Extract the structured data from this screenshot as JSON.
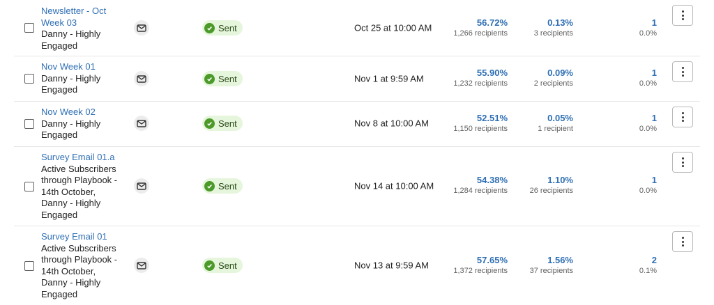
{
  "rows": [
    {
      "title": "Newsletter - Oct Week 03",
      "audience": "Danny - Highly Engaged",
      "status": "Sent",
      "date": "Oct 25 at 10:00 AM",
      "open_rate": "56.72%",
      "open_recipients": "1,266 recipients",
      "click_rate": "0.13%",
      "click_recipients": "3 recipients",
      "unsub_count": "1",
      "unsub_rate": "0.0%"
    },
    {
      "title": "Nov Week 01",
      "audience": "Danny - Highly Engaged",
      "status": "Sent",
      "date": "Nov 1 at 9:59 AM",
      "open_rate": "55.90%",
      "open_recipients": "1,232 recipients",
      "click_rate": "0.09%",
      "click_recipients": "2 recipients",
      "unsub_count": "1",
      "unsub_rate": "0.0%"
    },
    {
      "title": "Nov Week 02",
      "audience": "Danny - Highly Engaged",
      "status": "Sent",
      "date": "Nov 8 at 10:00 AM",
      "open_rate": "52.51%",
      "open_recipients": "1,150 recipients",
      "click_rate": "0.05%",
      "click_recipients": "1 recipient",
      "unsub_count": "1",
      "unsub_rate": "0.0%"
    },
    {
      "title": "Survey Email 01.a",
      "audience": "Active Subscribers through Playbook - 14th October, Danny - Highly Engaged",
      "status": "Sent",
      "date": "Nov 14 at 10:00 AM",
      "open_rate": "54.38%",
      "open_recipients": "1,284 recipients",
      "click_rate": "1.10%",
      "click_recipients": "26 recipients",
      "unsub_count": "1",
      "unsub_rate": "0.0%"
    },
    {
      "title": "Survey Email 01",
      "audience": "Active Subscribers through Playbook - 14th October, Danny - Highly Engaged",
      "status": "Sent",
      "date": "Nov 13 at 9:59 AM",
      "open_rate": "57.65%",
      "open_recipients": "1,372 recipients",
      "click_rate": "1.56%",
      "click_recipients": "37 recipients",
      "unsub_count": "2",
      "unsub_rate": "0.1%"
    }
  ],
  "icons": {
    "type": "envelope-icon",
    "status": "check-circle-icon",
    "more": "more-vertical-icon"
  },
  "colors": {
    "link": "#2f6fb4",
    "status_bg": "#e6f6dc",
    "status_check": "#4c9a2a"
  }
}
